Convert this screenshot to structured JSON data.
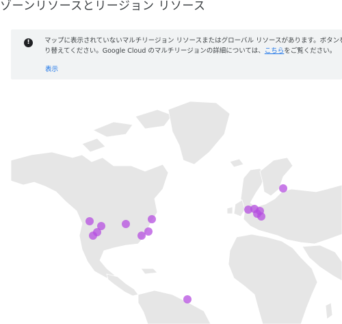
{
  "page": {
    "title": "ゾーンリソースとリージョン リソース"
  },
  "banner": {
    "icon": "info-icon",
    "message_line1": "マップに表示されていないマルチリージョン リソースまたはグローバル リソースがあります。ボタンをクリックして表示を切",
    "message_line2_before": "り替えてください。Google Cloud のマルチリージョンの詳細については、",
    "message_link": "こちら",
    "message_line2_after": "をご覧ください。",
    "show_button": "表示"
  },
  "map": {
    "land_color": "#e6e6e6",
    "marker_color": "#b54fe0",
    "markers": [
      {
        "region": "north-america-west-1"
      },
      {
        "region": "north-america-west-2"
      },
      {
        "region": "north-america-west-3"
      },
      {
        "region": "north-america-west-4"
      },
      {
        "region": "north-america-central"
      },
      {
        "region": "north-america-east-1"
      },
      {
        "region": "north-america-east-2"
      },
      {
        "region": "north-america-east-3"
      },
      {
        "region": "south-america-east"
      },
      {
        "region": "europe-west-1"
      },
      {
        "region": "europe-west-2"
      },
      {
        "region": "europe-west-3"
      },
      {
        "region": "europe-west-4"
      },
      {
        "region": "europe-central"
      },
      {
        "region": "europe-north"
      }
    ]
  }
}
